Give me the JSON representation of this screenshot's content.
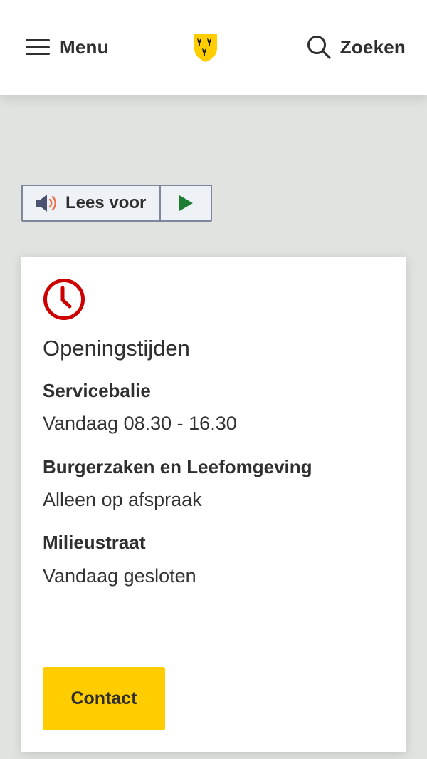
{
  "header": {
    "menu_label": "Menu",
    "search_label": "Zoeken",
    "logo_icon": "coat-of-arms-icon",
    "brand_color": "#ffcd00"
  },
  "readspeaker": {
    "label": "Lees voor",
    "speaker_icon": "speaker-icon",
    "play_icon": "play-icon",
    "play_color": "#1e7d32"
  },
  "opening_hours": {
    "icon": "clock-icon",
    "icon_color": "#cc0000",
    "title": "Openingstijden",
    "items": [
      {
        "name": "Servicebalie",
        "value": "Vandaag 08.30 - 16.30"
      },
      {
        "name": "Burgerzaken en Leefomgeving",
        "value": "Alleen op afspraak"
      },
      {
        "name": "Milieustraat",
        "value": "Vandaag gesloten"
      }
    ],
    "contact_label": "Contact"
  }
}
